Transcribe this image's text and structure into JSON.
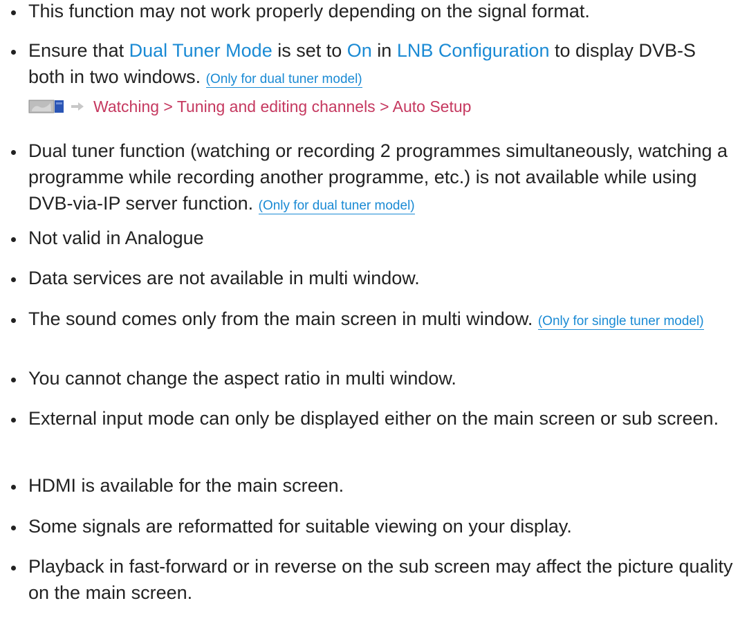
{
  "notes": [
    {
      "text": "This function may not work properly depending on the signal format."
    },
    {
      "parts": [
        "Ensure that ",
        "Dual Tuner Mode",
        " is set to ",
        "On",
        " in ",
        "LNB Configuration",
        " to display DVB-S both in two windows. "
      ],
      "model_note": "(Only for dual tuner model)"
    },
    {
      "text": "Dual tuner function (watching or recording 2 programmes simultaneously, watching a programme while recording another programme, etc.) is not available while using DVB-via-IP server function. ",
      "model_note": "(Only for dual tuner model)"
    },
    {
      "text": "Not valid in Analogue"
    },
    {
      "text": "Data services are not available in multi window."
    },
    {
      "text": "The sound comes only from the main screen in multi window. ",
      "model_note": "(Only for single tuner model)"
    },
    {
      "text": "You cannot change the aspect ratio in multi window."
    },
    {
      "text": "External input mode can only be displayed either on the main screen or sub screen."
    },
    {
      "text": "HDMI is available for the main screen."
    },
    {
      "text": "Some signals are reformatted for suitable viewing on your display."
    },
    {
      "text": "Playback in fast-forward or in reverse on the sub screen may affect the picture quality on the main screen."
    }
  ],
  "reference": {
    "icon": "tv-menu-icon",
    "arrow_icon": "arrow-right-icon",
    "path": "Watching > Tuning and editing channels > Auto Setup"
  },
  "colors": {
    "link": "#1a8ad4",
    "reference": "#c5385f",
    "text": "#222222"
  }
}
